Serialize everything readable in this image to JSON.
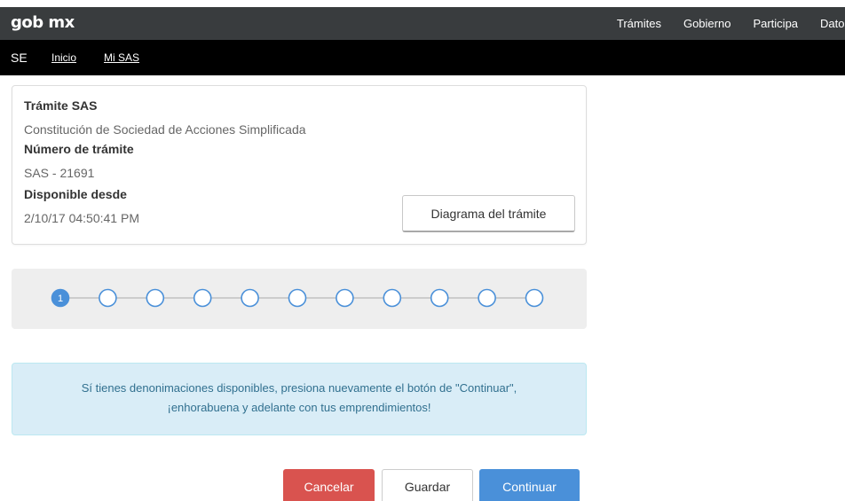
{
  "header": {
    "logo": "gob mx",
    "nav": [
      "Trámites",
      "Gobierno",
      "Participa",
      "Datos"
    ]
  },
  "subnav": {
    "section": "SE",
    "links": [
      "Inicio",
      "Mi SAS"
    ]
  },
  "card": {
    "title": "Trámite SAS",
    "description": "Constitución de Sociedad de Acciones Simplificada",
    "number_label": "Número de trámite",
    "number_value": "SAS - 21691",
    "available_label": "Disponible desde",
    "available_value": "2/10/17 04:50:41 PM",
    "diagram_button": "Diagrama del trámite"
  },
  "stepper": {
    "total_steps": 11,
    "current_step": 1,
    "current_label": "1",
    "accent_color": "#4a90d9"
  },
  "alert": {
    "line1": "Sí tienes denonimaciones disponibles, presiona nuevamente el botón de \"Continuar\",",
    "line2": "¡enhorabuena y adelante con tus emprendimientos!"
  },
  "actions": {
    "cancel": "Cancelar",
    "save": "Guardar",
    "continue": "Continuar"
  },
  "colors": {
    "topbar": "#393c3e",
    "subbar": "#000000",
    "cancel": "#d9534f",
    "continue": "#4a90d9",
    "alert_bg": "#d9edf7"
  }
}
